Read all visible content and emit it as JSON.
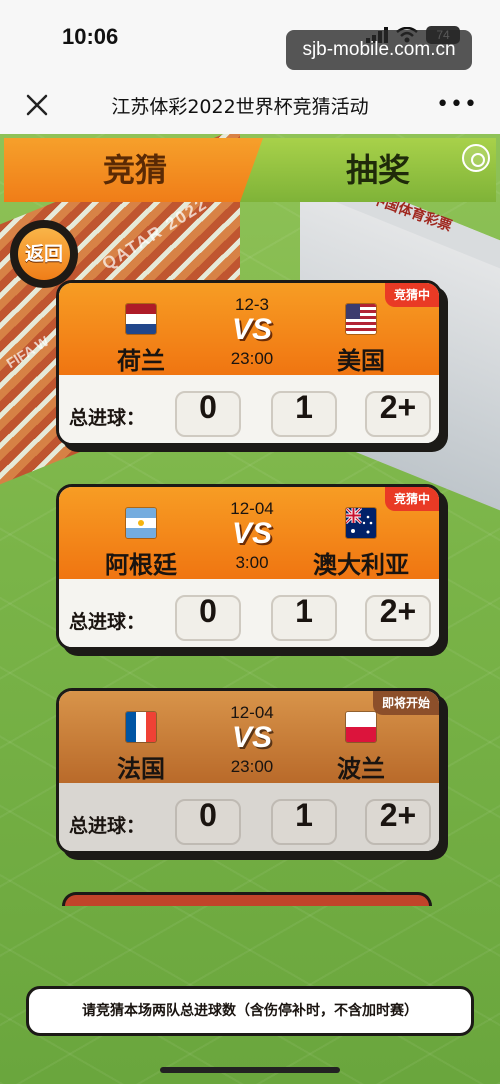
{
  "status_bar": {
    "time": "10:06",
    "battery": "74",
    "watermark": "sjb-mobile.com.cn"
  },
  "nav": {
    "title": "江苏体彩2022世界杯竞猜活动",
    "more": "•••",
    "close_icon": "close-icon"
  },
  "tabs": {
    "guess": "竞猜",
    "lottery": "抽奖"
  },
  "back_button": "返回",
  "scene": {
    "sign": "中国体育彩票",
    "banner": "QATAR 2022",
    "fifa": "FIFA W"
  },
  "goals_label": "总进球：",
  "options": [
    "0",
    "1",
    "2+"
  ],
  "matches": [
    {
      "status": "竞猜中",
      "date": "12-3",
      "vs": "VS",
      "time": "23:00",
      "home": "荷兰",
      "away": "美国",
      "home_flag": "netherlands-flag",
      "away_flag": "usa-flag"
    },
    {
      "status": "竞猜中",
      "date": "12-04",
      "vs": "VS",
      "time": "3:00",
      "home": "阿根廷",
      "away": "澳大利亚",
      "home_flag": "argentina-flag",
      "away_flag": "australia-flag"
    },
    {
      "status": "即将开始",
      "date": "12-04",
      "vs": "VS",
      "time": "23:00",
      "home": "法国",
      "away": "波兰",
      "home_flag": "france-flag",
      "away_flag": "poland-flag"
    }
  ],
  "footer_note": "请竞猜本场两队总进球数（含伤停补时，不含加时赛）",
  "colors": {
    "active_card": "#f07511",
    "upcoming_card": "#b96a2a",
    "badge_red": "#e93a25",
    "field_green": "#7ab448"
  }
}
